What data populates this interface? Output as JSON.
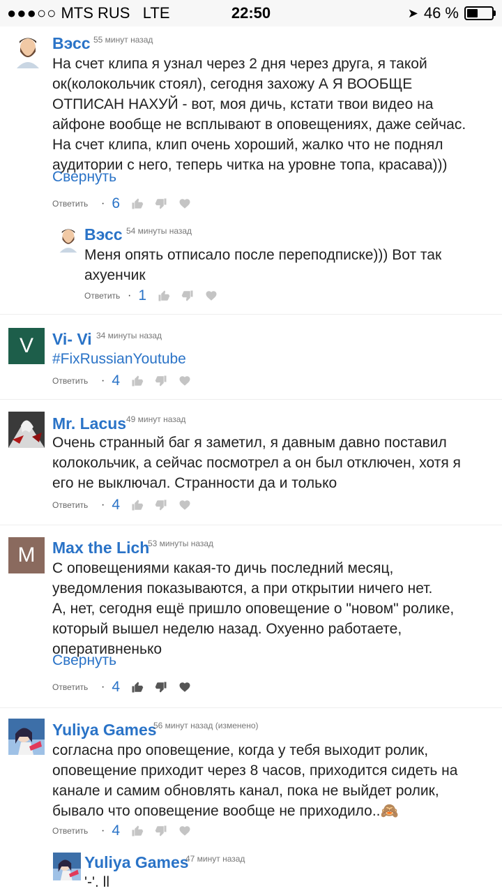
{
  "status_bar": {
    "carrier": "MTS RUS",
    "network": "LTE",
    "time": "22:50",
    "battery": "46 %",
    "battery_level": 0.46
  },
  "comments": [
    {
      "author": "Вэсс",
      "time": "55 минут назад",
      "text": "На счет клипа я узнал через 2 дня через друга, я такой\nок(колокольчик стоял), сегодня захожу А Я ВООБЩЕ\nОТПИСАН НАХУЙ - вот, моя дичь, кстати твои видео на\nайфоне вообще не всплывают в оповещениях, даже сейчас.\nНа счет клипа, клип очень хороший, жалко что не поднял\nаудитории с него, теперь читка на уровне топа, красава)))",
      "collapse": "Свернуть",
      "reply": "Ответить",
      "likes": "6"
    },
    {
      "author": "Вэсс",
      "time": "54 минуты назад",
      "text": "Меня опять отписало после переподписке))) Вот так\nахуенчик",
      "reply": "Ответить",
      "likes": "1"
    },
    {
      "author": "Vi- Vi",
      "avatar_letter": "V",
      "avatar_color": "#1d5e4a",
      "time": "34 минуты назад",
      "text": "#FixRussianYoutube",
      "reply": "Ответить",
      "likes": "4"
    },
    {
      "author": "Mr. Lacus",
      "time": "49 минут назад",
      "text": "Очень странный баг я заметил, я давным давно поставил\nколокольчик, а сейчас посмотрел а он был отключен, хотя я\nего не выключал. Странности да и только",
      "reply": "Ответить",
      "likes": "4"
    },
    {
      "author": "Max the Lich",
      "avatar_letter": "M",
      "avatar_color": "#8a6a5e",
      "time": "53 минуты назад",
      "text": "С оповещениями какая-то дичь последний месяц,\nуведомления показываются, а при открытии ничего нет.\nА, нет, сегодня ещё пришло оповещение о \"новом\" ролике,\nкоторый вышел неделю назад. Охуенно работаете,\nоперативненько",
      "collapse": "Свернуть",
      "reply": "Ответить",
      "likes": "4"
    },
    {
      "author": "Yuliya Games",
      "time": "56 минут назад (изменено)",
      "text": "согласна про оповещение, когда у тебя выходит ролик,\nоповещение приходит через 8 часов, приходится сидеть на\nканале и самим обновлять канал, пока не выйдет ролик,\nбывало что оповещение вообще не приходило..🙈",
      "reply": "Ответить",
      "likes": "4"
    },
    {
      "author": "Yuliya Games",
      "time": "47 минут назад",
      "text": "'-'. ll"
    }
  ],
  "icons": {
    "like": "thumbs-up-icon",
    "dislike": "thumbs-down-icon",
    "heart": "heart-icon",
    "location": "location-arrow-icon"
  }
}
